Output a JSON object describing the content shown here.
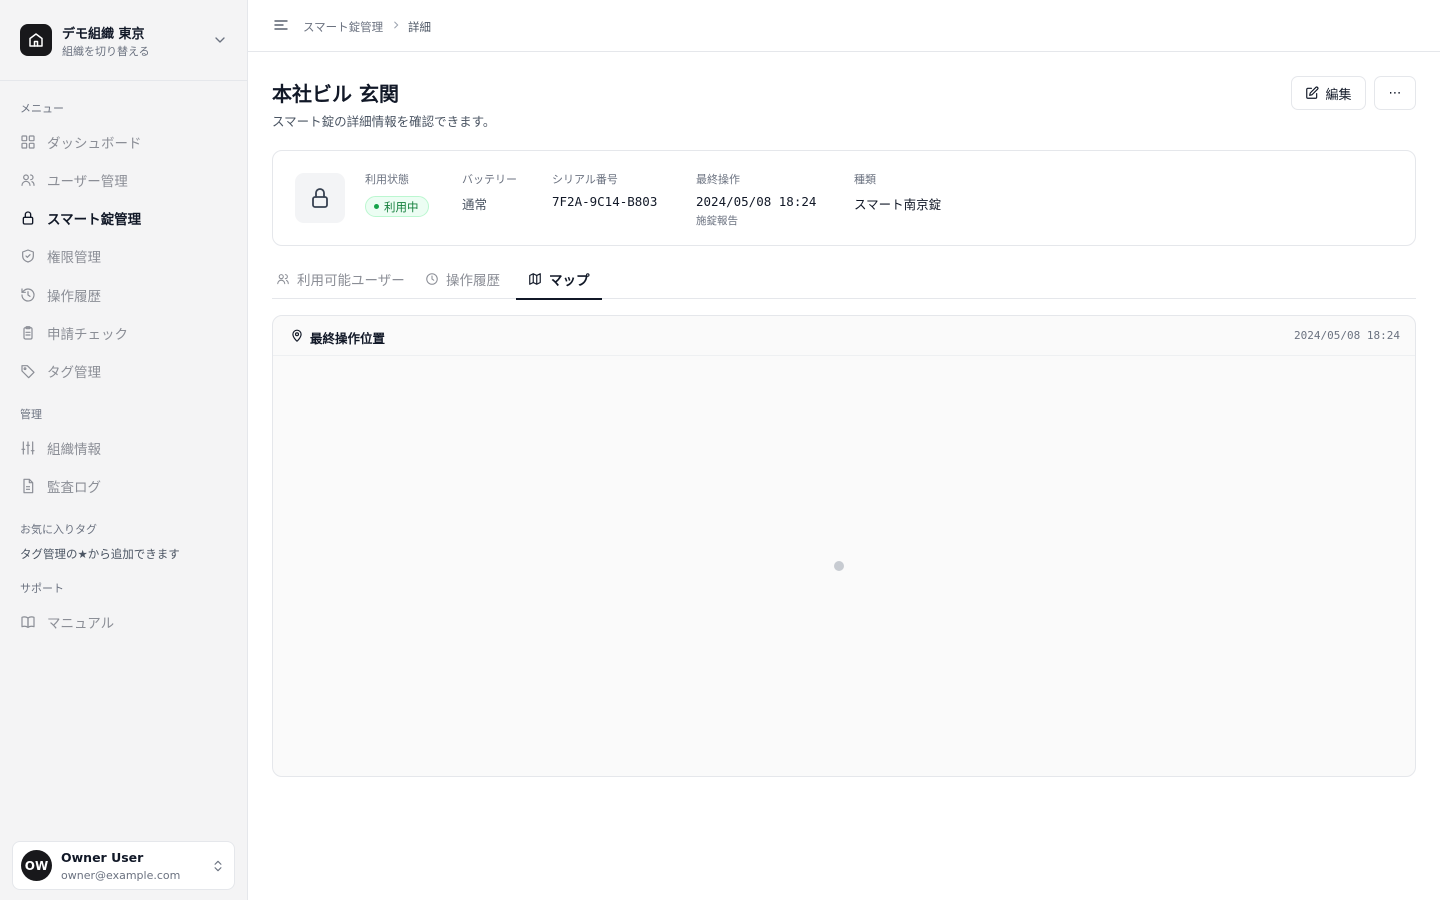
{
  "org": {
    "name": "デモ組織 東京",
    "switch_label": "組織を切り替える"
  },
  "sidebar": {
    "menu_label": "メニュー",
    "menu_items": [
      {
        "label": "ダッシュボード",
        "icon": "grid-icon"
      },
      {
        "label": "ユーザー管理",
        "icon": "users-icon"
      },
      {
        "label": "スマート錠管理",
        "icon": "lock-icon",
        "active": true
      },
      {
        "label": "権限管理",
        "icon": "shield-check-icon"
      },
      {
        "label": "操作履歴",
        "icon": "history-icon"
      },
      {
        "label": "申請チェック",
        "icon": "clipboard-icon"
      },
      {
        "label": "タグ管理",
        "icon": "tag-icon"
      }
    ],
    "admin_label": "管理",
    "admin_items": [
      {
        "label": "組織情報",
        "icon": "sliders-icon"
      },
      {
        "label": "監査ログ",
        "icon": "file-icon"
      }
    ],
    "favorites_label": "お気に入りタグ",
    "favorites_hint": "タグ管理の★から追加できます",
    "support_label": "サポート",
    "support_items": [
      {
        "label": "マニュアル",
        "icon": "book-icon"
      }
    ]
  },
  "user": {
    "initials": "OW",
    "name": "Owner User",
    "email": "owner@example.com"
  },
  "breadcrumb": {
    "parent": "スマート錠管理",
    "current": "詳細"
  },
  "page": {
    "title": "本社ビル 玄関",
    "subtitle": "スマート錠の詳細情報を確認できます。",
    "edit_label": "編集",
    "more_label": "⋯"
  },
  "info": {
    "status_label": "利用状態",
    "status_value": "利用中",
    "battery_label": "バッテリー",
    "battery_value": "通常",
    "serial_label": "シリアル番号",
    "serial_value": "7F2A-9C14-B803",
    "last_op_label": "最終操作",
    "last_op_value": "2024/05/08 18:24",
    "last_op_note": "施錠報告",
    "type_label": "種類",
    "type_value": "スマート南京錠"
  },
  "tabs": [
    {
      "label": "利用可能ユーザー",
      "icon": "users-icon"
    },
    {
      "label": "操作履歴",
      "icon": "clock-icon"
    },
    {
      "label": "マップ",
      "icon": "map-icon",
      "active": true
    }
  ],
  "map": {
    "title": "最終操作位置",
    "timestamp": "2024/05/08 18:24"
  },
  "colors": {
    "accent": "#111827",
    "status_green": "#15803d",
    "sidebar_bg": "#f4f4f5"
  }
}
